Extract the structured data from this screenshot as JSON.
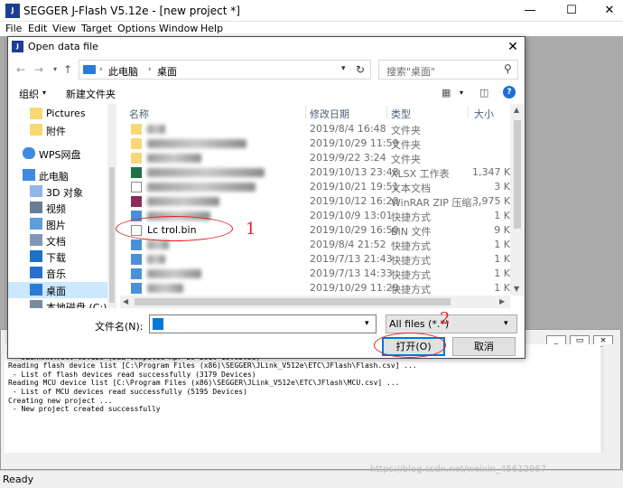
{
  "app": {
    "title": "SEGGER J-Flash V5.12e - [new project *]",
    "icon_text": "J",
    "menu": [
      "File",
      "Edit",
      "View",
      "Target",
      "Options",
      "Window",
      "Help"
    ],
    "status": "Ready",
    "watermark": "https://blog.csdn.net/weixin_45612967"
  },
  "log": {
    "lines": [
      " - JLinkARM.dll V5.12e (DLL compiled Apr 29 2016 15:03:58)",
      " - JLinkARM.dll V5.12e (DLL compiled Apr 29 2016 15:03:58)",
      "Reading flash device list [C:\\Program Files (x86)\\SEGGER\\JLink_V512e\\ETC\\JFlash\\Flash.csv] ...",
      " - List of flash devices read successfully (3179 Devices)",
      "Reading MCU device list [C:\\Program Files (x86)\\SEGGER\\JLink_V512e\\ETC\\JFlash\\MCU.csv] ...",
      " - List of MCU devices read successfully (5195 Devices)",
      "Creating new project ...",
      " - New project created successfully"
    ]
  },
  "dialog": {
    "title": "Open data file",
    "icon_text": "J",
    "breadcrumb": [
      "此电脑",
      "桌面"
    ],
    "search_placeholder": "搜索\"桌面\"",
    "toolbar": {
      "organize": "组织",
      "new_folder": "新建文件夹"
    },
    "nav_items": [
      {
        "label": "Pictures",
        "icon": "folder-icon",
        "selected": false
      },
      {
        "label": "附件",
        "icon": "folder-icon",
        "selected": false
      },
      {
        "label": "WPS网盘",
        "icon": "cloud-icon",
        "selected": false
      },
      {
        "label": "此电脑",
        "icon": "computer-icon",
        "selected": false
      },
      {
        "label": "3D 对象",
        "icon": "3d-objects-icon",
        "selected": false
      },
      {
        "label": "视频",
        "icon": "video-icon",
        "selected": false
      },
      {
        "label": "图片",
        "icon": "pictures-icon",
        "selected": false
      },
      {
        "label": "文档",
        "icon": "documents-icon",
        "selected": false
      },
      {
        "label": "下载",
        "icon": "download-icon",
        "selected": false
      },
      {
        "label": "音乐",
        "icon": "music-icon",
        "selected": false
      },
      {
        "label": "桌面",
        "icon": "desktop-icon",
        "selected": true
      },
      {
        "label": "本地磁盘 (C:)",
        "icon": "drive-icon",
        "selected": false
      }
    ],
    "columns": [
      "名称",
      "修改日期",
      "类型",
      "大小"
    ],
    "files": [
      {
        "name": "",
        "date": "2019/8/4 16:48",
        "type": "文件夹",
        "size": "",
        "icon": "folder-icon"
      },
      {
        "name": "",
        "date": "2019/10/29 11:59",
        "type": "文件夹",
        "size": "",
        "icon": "folder-icon"
      },
      {
        "name": "",
        "date": "2019/9/22 3:24",
        "type": "文件夹",
        "size": "",
        "icon": "folder-icon"
      },
      {
        "name": "",
        "date": "2019/10/13 23:48",
        "type": "XLSX 工作表",
        "size": "1,347 K",
        "icon": "xlsx-icon"
      },
      {
        "name": "",
        "date": "2019/10/21 19:51",
        "type": "文本文档",
        "size": "3 K",
        "icon": "text-file-icon"
      },
      {
        "name": "",
        "date": "2019/10/12 16:20",
        "type": "WinRAR ZIP 压缩...",
        "size": "3,975 K",
        "icon": "zip-icon"
      },
      {
        "name": "",
        "date": "2019/10/9 13:01",
        "type": "快捷方式",
        "size": "1 K",
        "icon": "shortcut-icon"
      },
      {
        "name": "Lc        trol.bin",
        "date": "2019/10/29 16:50",
        "type": "BIN 文件",
        "size": "9 K",
        "icon": "bin-file-icon"
      },
      {
        "name": "",
        "date": "2019/8/4 21:52",
        "type": "快捷方式",
        "size": "1 K",
        "icon": "shortcut-icon"
      },
      {
        "name": "",
        "date": "2019/7/13 21:43",
        "type": "快捷方式",
        "size": "1 K",
        "icon": "shortcut-icon"
      },
      {
        "name": "",
        "date": "2019/7/13 14:33",
        "type": "快捷方式",
        "size": "1 K",
        "icon": "shortcut-icon"
      },
      {
        "name": "",
        "date": "2019/10/29 11:29",
        "type": "快捷方式",
        "size": "1 K",
        "icon": "shortcut-icon"
      }
    ],
    "filename_label": "文件名(N):",
    "filename_value": "",
    "filter_value": "All files (*.*)",
    "open_label": "打开(O)",
    "cancel_label": "取消"
  },
  "annotations": [
    "1",
    "2"
  ],
  "colors": {
    "accent": "#0078d7",
    "annotation": "#e02020",
    "selection": "#cce8ff"
  }
}
